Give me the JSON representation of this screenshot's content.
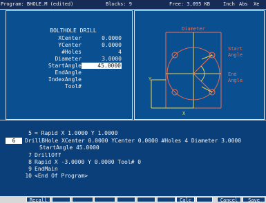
{
  "status": {
    "program": "Program: BHOLE.M (edited)",
    "blocks": "Blocks: 9",
    "free": "Free: 3,095 KB",
    "mode": "Inch",
    "abs": "Abs",
    "state": "Xe"
  },
  "form": {
    "title": "BOLTHOLE DRILL",
    "fields": [
      {
        "label": "XCenter",
        "value": "0.0000"
      },
      {
        "label": "YCenter",
        "value": "0.0000"
      },
      {
        "label": "#Holes",
        "value": "4"
      },
      {
        "label": "Diameter",
        "value": "3.0000"
      },
      {
        "label": "StartAngle",
        "value": "45.0000"
      },
      {
        "label": "EndAngle",
        "value": ""
      },
      {
        "label": "IndexAngle",
        "value": ""
      },
      {
        "label": "Tool#",
        "value": ""
      }
    ]
  },
  "diagram": {
    "diameter": "Diameter",
    "start_angle": "Start Angle",
    "start_1": "Start",
    "start_2": "Angle",
    "end_1": "End",
    "end_2": "Angle",
    "x_label": "X",
    "y_label": "Y"
  },
  "program": {
    "lines": [
      {
        "num": "5",
        "text": "= Rapid        X 1.0000 Y 1.0000",
        "current": false
      },
      {
        "num": "6",
        "text": "DrillBHole XCenter 0.0000 YCenter 0.0000 #Holes 4 Diameter 3.0000",
        "current": true
      },
      {
        "num": "",
        "text": "StartAngle 45.0000",
        "current": false
      },
      {
        "num": "7",
        "text": "DrillOff",
        "current": false
      },
      {
        "num": "8",
        "text": "Rapid        X -3.0000 Y 0.0000 Tool# 0",
        "current": false
      },
      {
        "num": "9",
        "text": "EndMain",
        "current": false
      },
      {
        "num": "10",
        "text": "<End Of Program>",
        "current": false
      }
    ]
  },
  "footer_keys": [
    "Recall",
    "",
    "",
    "",
    "",
    "",
    "",
    "Calc",
    "",
    "Cancel",
    "Save"
  ]
}
